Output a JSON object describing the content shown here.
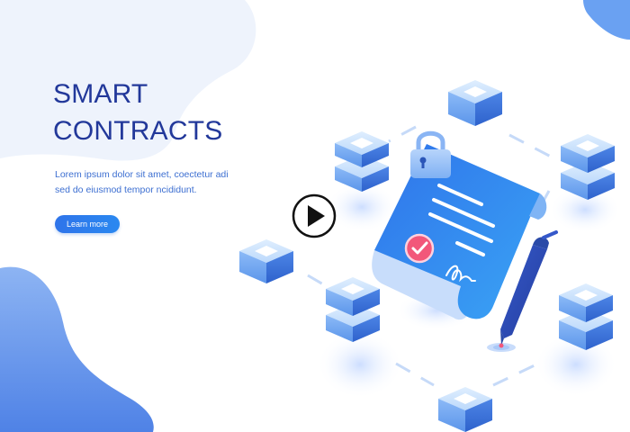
{
  "hero": {
    "title_line1": "SMART",
    "title_line2": "CONTRACTS",
    "description": "Lorem ipsum dolor sit amet, coectetur adi sed do eiusmod tempor  ncididunt.",
    "button_label": "Learn more"
  },
  "icons": {
    "play": "play-icon",
    "padlock": "padlock-icon",
    "pen": "pen-icon",
    "checkmark": "checkmark-icon",
    "signature": "signature-icon"
  },
  "colors": {
    "title": "#22389a",
    "text": "#3d6fd1",
    "button": "#2f74ea",
    "blob": "#eef3fc",
    "document": "#2e7cf0",
    "check_badge": "#f2577a"
  }
}
